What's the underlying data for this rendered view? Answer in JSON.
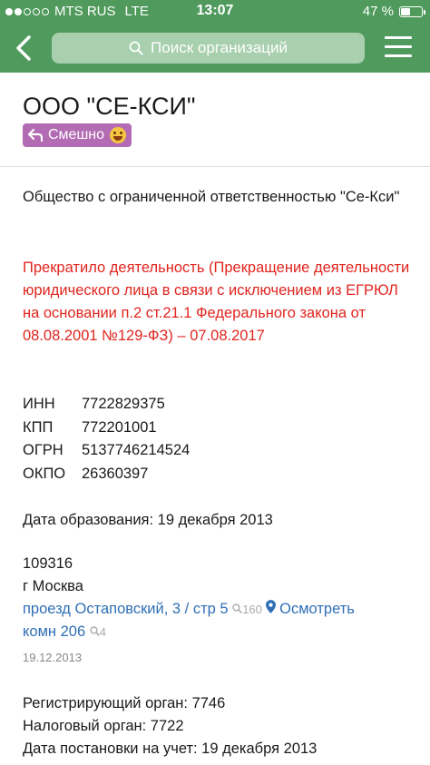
{
  "status_bar": {
    "carrier": "MTS RUS",
    "network": "LTE",
    "time": "13:07",
    "battery": "47 %",
    "battery_level": 0.47,
    "signal_bars_filled": 2,
    "signal_bars_total": 5
  },
  "nav": {
    "search_placeholder": "Поиск организаций",
    "back_icon": "chevron-left-icon",
    "search_icon": "search-icon",
    "menu_icon": "hamburger-menu-icon",
    "accent_color": "#4f9a5c"
  },
  "company": {
    "title": "ООО \"СЕ-КСИ\"",
    "badge_label": "Смешно",
    "badge_icon": "back-arrow-icon",
    "badge_emoji": "grinning-sweat-emoji",
    "badge_color": "#b36bb3",
    "full_name": "Общество с ограниченной ответственностью \"Се-Кси\"",
    "status": "Прекратило деятельность (Прекращение деятельности юридического лица в связи с исключением из ЕГРЮЛ на основании п.2 ст.21.1 Федерального закона от 08.08.2001 №129-ФЗ) – 07.08.2017",
    "status_color": "#e0251e"
  },
  "codes": [
    {
      "label": "ИНН",
      "value": "7722829375"
    },
    {
      "label": "КПП",
      "value": "772201001"
    },
    {
      "label": "ОГРН",
      "value": "5137746214524"
    },
    {
      "label": "ОКПО",
      "value": "26360397"
    }
  ],
  "formed": "Дата образования: 19 декабря 2013",
  "address": {
    "postcode": "109316",
    "city": "г Москва",
    "street_part1": "проезд Остаповский, 3 / стр 5",
    "street_count": "160",
    "map_link": "Осмотреть",
    "street_part2": "комн 206",
    "room_count": "4",
    "date": "19.12.2013"
  },
  "registration": {
    "authority": "Регистрирующий орган: 7746",
    "tax": "Налоговый орган: 7722",
    "date": "Дата постановки на учет: 19 декабря 2013"
  }
}
